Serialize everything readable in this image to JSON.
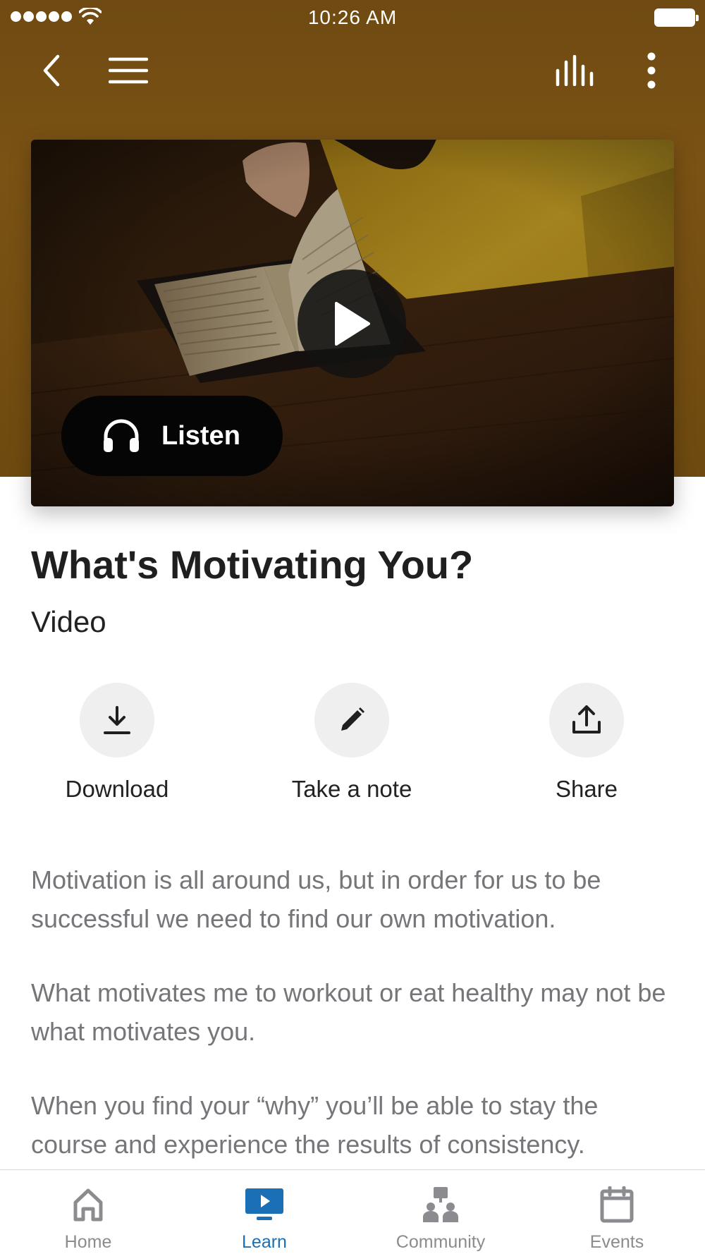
{
  "status_bar": {
    "time": "10:26 AM",
    "signal_icon": "signal-dots-icon",
    "wifi_icon": "wifi-icon",
    "battery_icon": "battery-icon"
  },
  "top_nav": {
    "back_icon": "back-chevron-icon",
    "menu_icon": "hamburger-menu-icon",
    "stats_icon": "audio-bars-icon",
    "more_icon": "more-vertical-icon"
  },
  "hero": {
    "play_icon": "play-icon",
    "listen_label": "Listen",
    "listen_icon": "headphones-icon"
  },
  "content": {
    "title": "What's Motivating You?",
    "type": "Video"
  },
  "actions": [
    {
      "label": "Download",
      "icon": "download-icon"
    },
    {
      "label": "Take a note",
      "icon": "pencil-icon"
    },
    {
      "label": "Share",
      "icon": "share-upload-icon"
    }
  ],
  "description": [
    "Motivation is all around us, but in order for us to be successful we need to find our own motivation.",
    "What motivates me to workout or eat healthy may not be what motivates you.",
    "When you find your “why” you’ll be able to stay the course and experience the results of consistency."
  ],
  "tab_bar": {
    "active": "Learn",
    "tabs": [
      {
        "label": "Home",
        "icon": "home-icon"
      },
      {
        "label": "Learn",
        "icon": "tv-play-icon"
      },
      {
        "label": "Community",
        "icon": "community-icon"
      },
      {
        "label": "Events",
        "icon": "calendar-icon"
      }
    ]
  },
  "colors": {
    "header_brown": "#7a5214",
    "accent_blue": "#1b6fb5",
    "inactive_gray": "#8c8c90",
    "body_text": "#76767a",
    "action_circle": "#efeff0"
  }
}
